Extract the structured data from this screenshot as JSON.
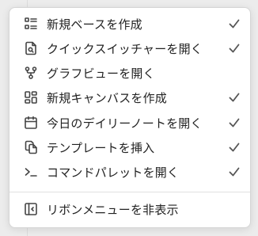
{
  "menu": {
    "items": [
      {
        "label": "新規ベースを作成",
        "icon": "list-icon",
        "checked": true
      },
      {
        "label": "クイックスイッチャーを開く",
        "icon": "file-search-icon",
        "checked": true
      },
      {
        "label": "グラフビューを開く",
        "icon": "git-fork-icon",
        "checked": false
      },
      {
        "label": "新規キャンバスを作成",
        "icon": "layout-dashboard-icon",
        "checked": true
      },
      {
        "label": "今日のデイリーノートを開く",
        "icon": "calendar-icon",
        "checked": true
      },
      {
        "label": "テンプレートを挿入",
        "icon": "files-icon",
        "checked": true
      },
      {
        "label": "コマンドパレットを開く",
        "icon": "terminal-icon",
        "checked": true
      }
    ],
    "footer_item": {
      "label": "リボンメニューを非表示",
      "icon": "panel-left-close-icon"
    }
  }
}
